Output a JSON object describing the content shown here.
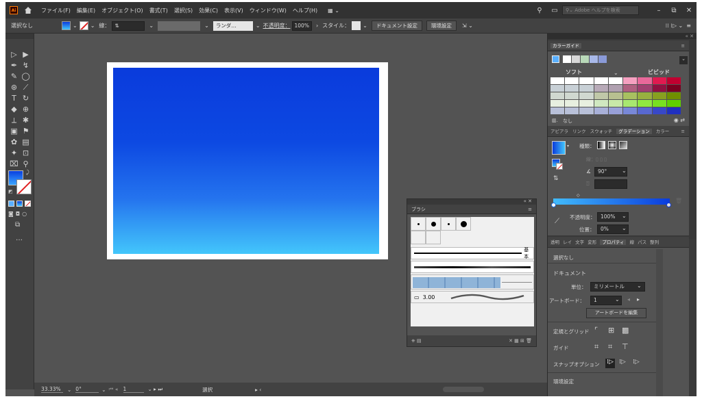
{
  "menubar": {
    "logo": "Ai",
    "items": [
      "ファイル(F)",
      "編集(E)",
      "オブジェクト(O)",
      "書式(T)",
      "選択(S)",
      "効果(C)",
      "表示(V)",
      "ウィンドウ(W)",
      "ヘルプ(H)"
    ],
    "search_placeholder": "Adobe ヘルプを検索"
  },
  "controlbar": {
    "selection": "選択なし",
    "stroke_label": "線：",
    "random_btn": "ランダ…",
    "opacity_label": "不透明度：",
    "opacity_value": "100%",
    "style_label": "スタイル：",
    "doc_settings_btn": "ドキュメント設定",
    "prefs_btn": "環境設定"
  },
  "statusbar": {
    "zoom": "33.33%",
    "rotation": "0°",
    "artboard_num": "1",
    "tool": "選択"
  },
  "brush_panel": {
    "tab": "ブラシ",
    "basic_label": "基本",
    "size_value": "3.00"
  },
  "color_guide": {
    "tab": "カラーガイド",
    "soft": "ソフト",
    "vivid": "ビビッド",
    "none_label": "なし",
    "rows": [
      [
        "#ffffff",
        "#ffffff",
        "#ffffff",
        "#ffffff",
        "#ffffff",
        "#f5a0c0",
        "#e8689a",
        "#e01a50",
        "#c00030"
      ],
      [
        "#c8d0d6",
        "#c8d0d6",
        "#c8d0d6",
        "#b8aab8",
        "#b0a0b0",
        "#b06080",
        "#a04070",
        "#901040",
        "#7a0020"
      ],
      [
        "#d0d8d0",
        "#d0d8d0",
        "#d0d8d0",
        "#c0c8a8",
        "#b8c090",
        "#a8c060",
        "#98b040",
        "#88a020",
        "#709000"
      ],
      [
        "#e8f0e0",
        "#e8f0e0",
        "#e8f0e0",
        "#d0e8c0",
        "#c8e8a8",
        "#a8e870",
        "#90e840",
        "#78e020",
        "#60d000"
      ],
      [
        "#b8c0d8",
        "#b8c0d8",
        "#b8c0d8",
        "#a8b0d8",
        "#98a0d8",
        "#7888d8",
        "#5868d0",
        "#3848c8",
        "#2030c0"
      ]
    ]
  },
  "gradient_panel": {
    "tabs": [
      "アピアラ",
      "リンク",
      "スウォッチ",
      "グラデーション",
      "カラー"
    ],
    "active_tab": "グラデーション",
    "type_label": "種類：",
    "angle_value": "90°",
    "opacity_label": "不透明度：",
    "opacity_value": "100%",
    "location_label": "位置：",
    "location_value": "0%"
  },
  "properties_panel": {
    "tabs": [
      "透明",
      "レイ",
      "文字",
      "変形",
      "プロパティ",
      "線",
      "パス",
      "整列"
    ],
    "active_tab": "プロパティ",
    "selection": "選択なし",
    "document_heading": "ドキュメント",
    "units_label": "単位：",
    "units_value": "ミリメートル",
    "artboard_label": "アートボード：",
    "artboard_value": "1",
    "edit_artboard_btn": "アートボードを編集",
    "rulers_grids_label": "定規とグリッド",
    "guides_label": "ガイド",
    "snap_label": "スナップオプション",
    "prefs_heading": "環境設定"
  },
  "colors": {
    "fill_top": "#0a3bdc",
    "fill_bottom": "#43c6fb",
    "ui_dark": "#323232",
    "ui_mid": "#424242",
    "ui_canvas": "#535353"
  }
}
